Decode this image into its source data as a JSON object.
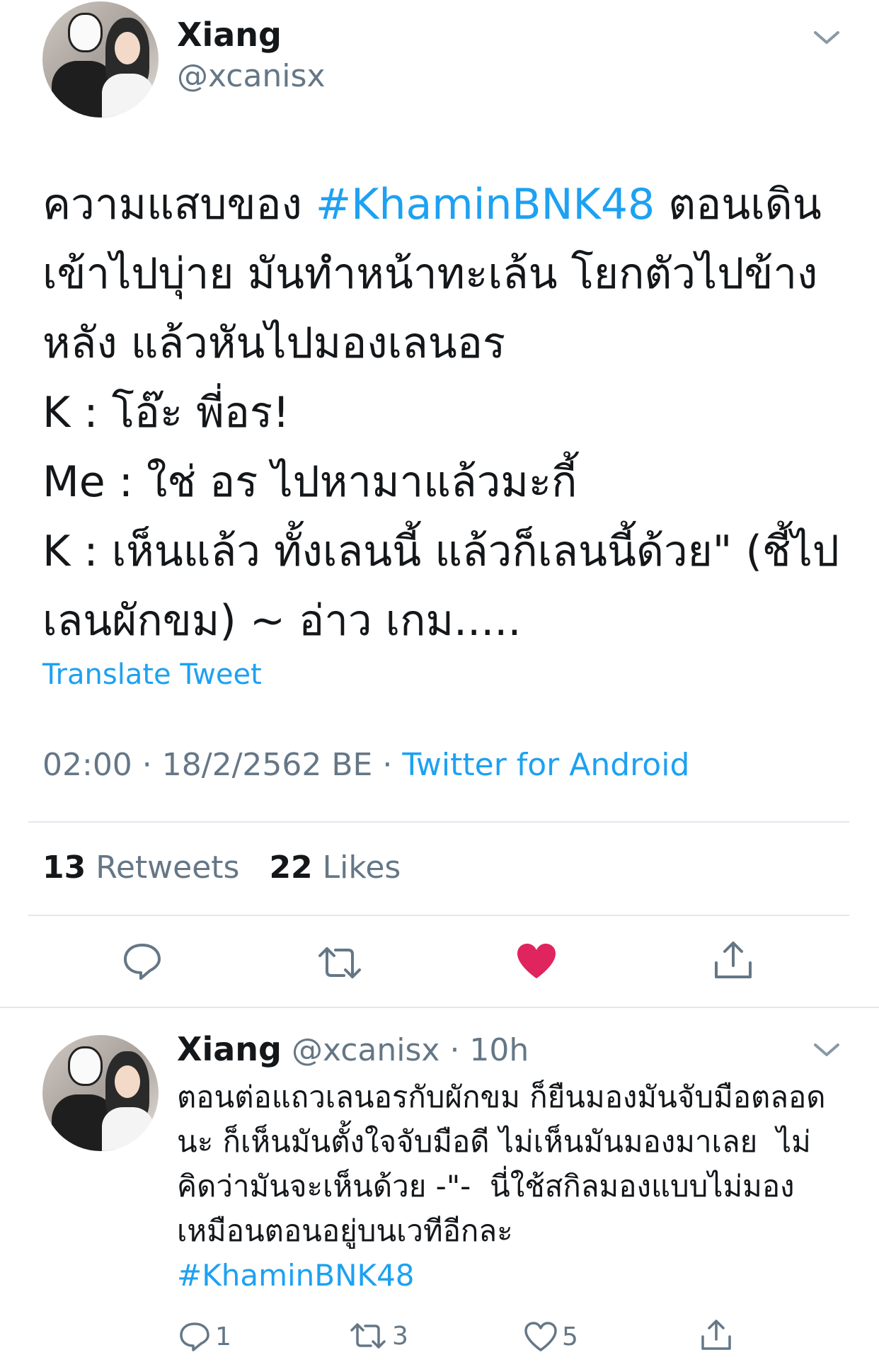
{
  "main_tweet": {
    "author_name": "Xiang",
    "author_handle": "@xcanisx",
    "text_before": "ความแสบของ ",
    "hashtag": "#KhaminBNK48",
    "text_after": " ตอนเดินเข้าไปบุ่าย มันทำหน้าทะเล้น โยกตัวไปข้างหลัง แล้วหันไปมองเลนอร\nK : โอ๊ะ พี่อร!\nMe : ใช่ อร ไปหามาแล้วมะกี้\nK : เห็นแล้ว ทั้งเลนนี้ แล้วก็เลนนี้ด้วย\" (ชี้ไปเลนผักขม) ~ อ่าว เกม.....",
    "translate_label": "Translate Tweet",
    "timestamp": "02:00 · 18/2/2562 BE · ",
    "source": "Twitter for Android",
    "retweets_count": "13",
    "retweets_label": "Retweets",
    "likes_count": "22",
    "likes_label": "Likes"
  },
  "reply_tweet": {
    "author_name": "Xiang",
    "author_handle": "@xcanisx",
    "time": "· 10h",
    "text": "ตอนต่อแถวเลนอรกับผักขม ก็ยืนมองมันจับมือตลอดนะ ก็เห็นมันตั้งใจจับมือดี ไม่เห็นมันมองมาเลย  ไม่คิดว่ามันจะเห็นด้วย -\"-  นี่ใช้สกิลมองแบบไม่มองเหมือนตอนอยู่บนเวทีอีกละ\n",
    "hashtag": "#KhaminBNK48",
    "reply_count": "1",
    "retweet_count": "3",
    "like_count": "5"
  },
  "colors": {
    "accent": "#1da1f2",
    "like": "#e0245e",
    "muted": "#657786",
    "divider": "#e1e8ed"
  }
}
